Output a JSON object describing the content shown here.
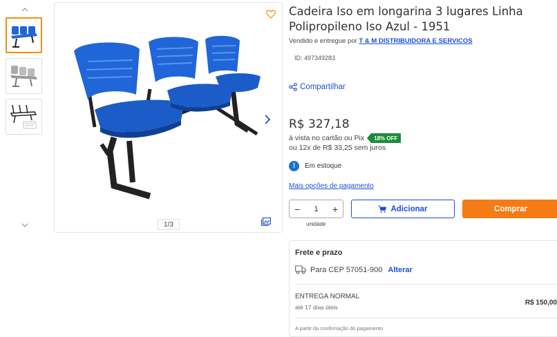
{
  "gallery": {
    "counter": "1/3",
    "thumbnails": [
      "blue-chair-thumb",
      "gray-chair-thumb",
      "black-frame-thumb"
    ]
  },
  "product": {
    "title": "Cadeira Iso em longarina 3 lugares Linha Polipropileno Iso Azul - 1951",
    "seller_prefix": "Vendido e entregue por",
    "seller_name": "T & M DISTRIBUIDORA E SERVICOS",
    "id": "ID: 497349283",
    "share_label": "Compartilhar"
  },
  "pricing": {
    "price": "R$ 327,18",
    "pix_text": "à vista no cartão ou Pix",
    "discount_badge": "18% OFF",
    "installments": "ou 12x de R$ 33,25 sem juros",
    "stock": "Em estoque",
    "more_payment": "Mais opções de pagamento"
  },
  "purchase": {
    "quantity": "1",
    "unit_label": "unidade",
    "add_label": "Adicionar",
    "buy_label": "Comprar"
  },
  "shipping": {
    "title": "Frete e prazo",
    "cep_text": "Para CEP 57051-900",
    "change_label": "Alterar",
    "delivery_name": "ENTREGA NORMAL",
    "delivery_days": "até 17 dias úteis",
    "delivery_price": "R$ 150,00",
    "note": "A partir da confirmação do pagamento"
  },
  "colors": {
    "accent_blue": "#1d4ed8",
    "buy_orange": "#f57c14",
    "discount_green": "#1a8c3a",
    "chair_blue": "#2166d8"
  }
}
